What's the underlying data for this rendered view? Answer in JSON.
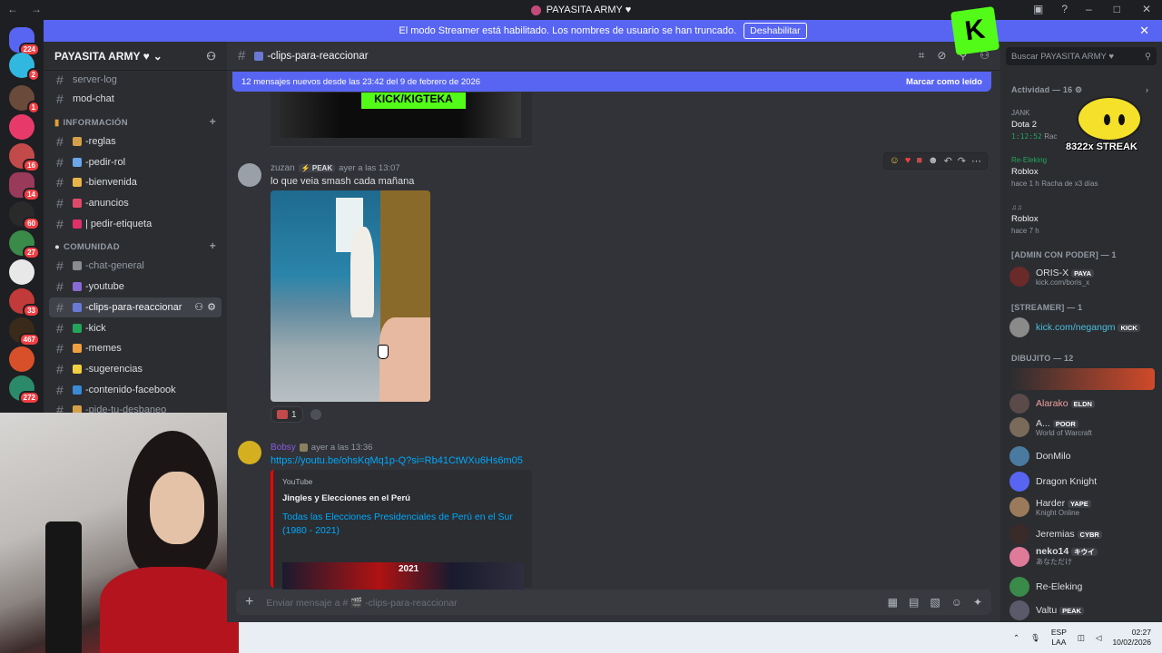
{
  "window": {
    "title": "PAYASITA ARMY ♥",
    "nav_back": "←",
    "nav_forward": "→"
  },
  "banner": {
    "text": "El modo Streamer está habilitado. Los nombres de usuario se han truncado.",
    "button": "Deshabilitar",
    "close": "✕"
  },
  "servers": {
    "home_badge": "224",
    "badges": [
      "2",
      "1",
      "16",
      "14",
      "60",
      "27",
      "33",
      "467",
      "272"
    ]
  },
  "server": {
    "name": "PAYASITA ARMY ♥",
    "channels_top": [
      {
        "name": "server-log"
      },
      {
        "name": "mod-chat"
      }
    ],
    "categories": [
      {
        "name": "INFORMACIÓN",
        "channels": [
          {
            "name": "-reglas",
            "color": "#d4a04a"
          },
          {
            "name": "-pedir-rol",
            "color": "#6aa6e8"
          },
          {
            "name": "-bienvenida",
            "color": "#e8b44a"
          },
          {
            "name": "-anuncios",
            "color": "#e04a6a"
          },
          {
            "name": "| pedir-etiqueta",
            "color": "#e0306a"
          }
        ]
      },
      {
        "name": "COMUNIDAD",
        "channels": [
          {
            "name": "-chat-general",
            "color": "#8a8c90"
          },
          {
            "name": "-youtube",
            "color": "#8a6ad4"
          },
          {
            "name": "-clips-para-reaccionar",
            "color": "#6a7ad4",
            "active": true
          },
          {
            "name": "-kick",
            "color": "#23a55a"
          },
          {
            "name": "-memes",
            "color": "#f0a040"
          },
          {
            "name": "-sugerencias",
            "color": "#f0d040"
          },
          {
            "name": "-contenido-facebook",
            "color": "#3a8ad4"
          },
          {
            "name": "-pide-tu-desbaneo",
            "color": "#d4a04a"
          }
        ]
      }
    ]
  },
  "channel": {
    "name": "-clips-para-reaccionar",
    "new_messages": "12 mensajes nuevos desde las 23:42 del 9 de febrero de 2026",
    "mark_read": "Marcar como leído",
    "composer_placeholder": "Enviar mensaje a # 🎬 -clips-para-reaccionar"
  },
  "messages": [
    {
      "author": "zuzan",
      "tag": "⚡ PEAK",
      "time": "ayer a las 13:07",
      "text": "lo que veia smash cada mañana",
      "reaction_count": "1"
    },
    {
      "author": "Bobsy",
      "time": "ayer a las 13:36",
      "link": "https://youtu.be/ohsKqMq1p-Q?si=Rb41CtWXu6Hs6m05",
      "embed": {
        "provider": "YouTube",
        "author": "Jingles y Elecciones en el Perú",
        "title": "Todas las Elecciones Presidenciales de Perú en el Sur (1980 - 2021)",
        "thumb_year": "2021"
      }
    }
  ],
  "previous_embed_text": "KICK/KIGTEKA",
  "members": {
    "search_placeholder": "Buscar PAYASITA ARMY ♥",
    "activity_header": "Actividad — 16",
    "activities": [
      {
        "name": "JANK",
        "game": "Dota 2",
        "timer": "1:12:52",
        "extra": "Rac"
      },
      {
        "name": "Re-Eleking",
        "game": "Roblox",
        "since": "hace 1 h",
        "extra": "Racha de x3 días"
      },
      {
        "name": "♫♫",
        "game": "Roblox",
        "since": "hace 7 h"
      }
    ],
    "streak": "8322x STREAK",
    "groups": [
      {
        "header": "[ADMIN CON PODER] — 1",
        "items": [
          {
            "name": "ORIS-X",
            "tag": "PAYA",
            "sub": "kick.com/boris_x"
          }
        ]
      },
      {
        "header": "[STREAMER] — 1",
        "items": [
          {
            "name": "kick.com/negangm",
            "tag": "KICK"
          }
        ]
      },
      {
        "header": "DIBUJITO — 12",
        "items": [
          {
            "name": "Alarako",
            "tag": "ELDN"
          },
          {
            "name": "A...",
            "tag": "POOR",
            "sub": "World of Warcraft"
          },
          {
            "name": "DonMilo"
          },
          {
            "name": "Dragon Knight"
          },
          {
            "name": "Harder",
            "tag": "YAPE",
            "sub": "Knight Online"
          },
          {
            "name": "Jeremias",
            "tag": "CYBR"
          },
          {
            "name": "neko14",
            "tag": "キウイ",
            "sub": "あなただけ"
          },
          {
            "name": "Re-Eleking"
          },
          {
            "name": "Valtu",
            "tag": "PEAK"
          }
        ]
      }
    ]
  },
  "taskbar": {
    "lang_top": "ESP",
    "lang_bottom": "LAA",
    "time": "02:27",
    "date": "10/02/2026"
  },
  "colors": {
    "accent": "#5865f2",
    "kick": "#53fc18",
    "link": "#00a8fc"
  }
}
